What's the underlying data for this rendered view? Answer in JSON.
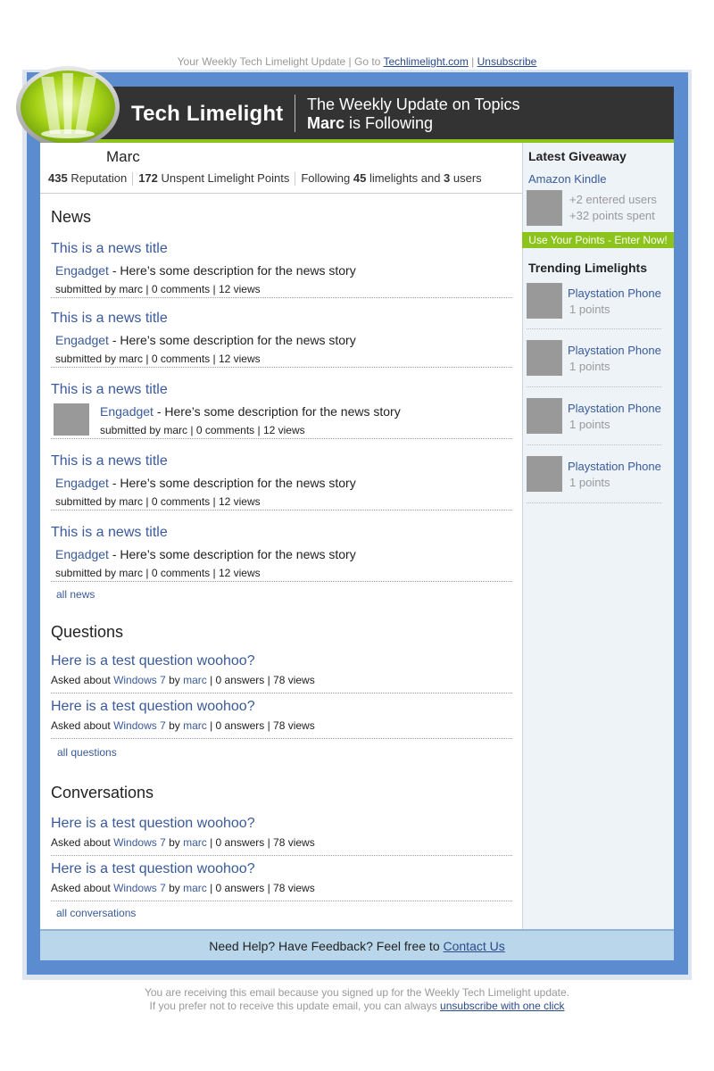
{
  "top_bar": {
    "prefix": "Your Weekly Tech Limelight Update | Go to ",
    "site_link": "Techlimelight.com",
    "divider": " | ",
    "unsubscribe": "Unsubscribe"
  },
  "header": {
    "brand": "Tech Limelight",
    "tagline_line1": "The Weekly Update on Topics",
    "tagline_user": "Marc",
    "tagline_rest": " is Following"
  },
  "profile": {
    "name": "Marc",
    "reputation_value": "435",
    "reputation_label": " Reputation",
    "points_value": "172",
    "points_label": " Unspent Limelight Points",
    "following_prefix": "Following ",
    "limelights_count": "45",
    "limelights_label": " limelights and ",
    "users_count": "3",
    "users_label": " users"
  },
  "news": {
    "heading": "News",
    "items": [
      {
        "title": "This is a news title",
        "source": "Engadget",
        "desc": " - Here’s some description for the news story",
        "meta": "submitted by marc | 0 comments | 12 views"
      },
      {
        "title": "This is a news title",
        "source": "Engadget",
        "desc": " - Here’s some description for the news story",
        "meta": "submitted by marc | 0 comments | 12 views"
      },
      {
        "title": "This is a news title",
        "source": "Engadget",
        "desc": " - Here’s some description for the news story",
        "meta": "submitted by marc | 0 comments | 12 views"
      },
      {
        "title": "This is a news title",
        "source": "Engadget",
        "desc": " - Here’s some description for the news story",
        "meta": "submitted by marc | 0 comments | 12 views"
      },
      {
        "title": "This is a news title",
        "source": "Engadget",
        "desc": " - Here’s some description for the news story",
        "meta": "submitted by marc | 0 comments | 12 views"
      }
    ],
    "more_link": "all news"
  },
  "questions": {
    "heading": "Questions",
    "items": [
      {
        "title": "Here is a test question woohoo?",
        "asked": "Asked about ",
        "topic": "Windows 7",
        "by": " by ",
        "user": "marc",
        "stats": " | 0 answers | 78 views"
      },
      {
        "title": "Here is a test question woohoo?",
        "asked": "Asked about ",
        "topic": "Windows 7",
        "by": " by ",
        "user": "marc",
        "stats": " | 0 answers | 78 views"
      }
    ],
    "more_link": "all questions"
  },
  "conversations": {
    "heading": "Conversations",
    "items": [
      {
        "title": "Here is a test question woohoo?",
        "asked": "Asked about ",
        "topic": "Windows 7",
        "by": " by ",
        "user": "marc",
        "stats": " | 0 answers | 78 views"
      },
      {
        "title": "Here is a test question woohoo?",
        "asked": "Asked about ",
        "topic": "Windows 7",
        "by": " by ",
        "user": "marc",
        "stats": " | 0 answers | 78 views"
      }
    ],
    "more_link": "all conversations"
  },
  "sidebar": {
    "giveaway_heading": "Latest Giveaway",
    "giveaway_item": "Amazon Kindle",
    "giveaway_entered": "+2 entered users",
    "giveaway_spent": "+32 points spent",
    "giveaway_cta": "Use Your Points - Enter Now!",
    "trending_heading": "Trending Limelights",
    "trending": [
      {
        "name": "Playstation Phone",
        "points": "1 points"
      },
      {
        "name": "Playstation Phone",
        "points": "1 points"
      },
      {
        "name": "Playstation Phone",
        "points": "1 points"
      },
      {
        "name": "Playstation Phone",
        "points": "1 points"
      }
    ]
  },
  "footer": {
    "help_text": "Need Help? Have Feedback? Feel free to ",
    "contact_link": "Contact Us"
  },
  "bottom": {
    "line1": "You are receiving this email because you signed up for the Weekly Tech Limelight update.",
    "line2_prefix": "If you prefer not to receive this update email, you can always ",
    "line2_link": "unsubscribe with one click"
  },
  "colors": {
    "frame_blue": "#5b8ccf",
    "header_dark": "#333333",
    "accent_green": "#8cc41c",
    "link_blue": "#3a5a9a"
  }
}
